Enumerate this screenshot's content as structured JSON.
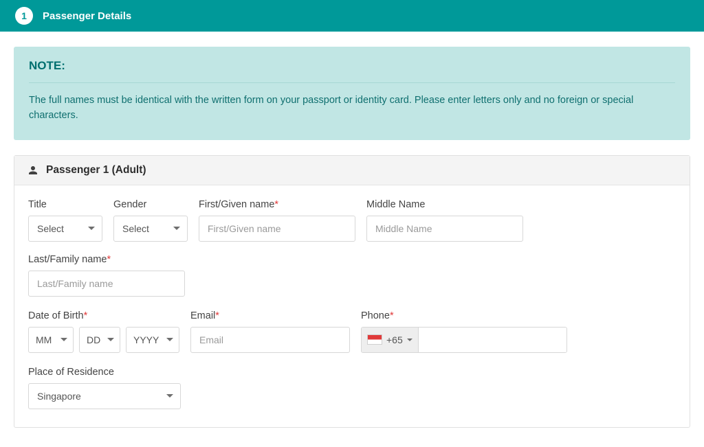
{
  "step": {
    "number": "1",
    "title": "Passenger Details"
  },
  "note": {
    "heading": "NOTE:",
    "text": "The full names must be identical with the written form on your passport or identity card. Please enter letters only and no foreign or special characters."
  },
  "passenger": {
    "header": "Passenger 1 (Adult)",
    "fields": {
      "title": {
        "label": "Title",
        "placeholder": "Select"
      },
      "gender": {
        "label": "Gender",
        "placeholder": "Select"
      },
      "first_name": {
        "label": "First/Given name",
        "placeholder": "First/Given name"
      },
      "middle_name": {
        "label": "Middle Name",
        "placeholder": "Middle Name"
      },
      "last_name": {
        "label": "Last/Family name",
        "placeholder": "Last/Family name"
      },
      "dob": {
        "label": "Date of Birth",
        "mm": "MM",
        "dd": "DD",
        "yyyy": "YYYY"
      },
      "email": {
        "label": "Email",
        "placeholder": "Email"
      },
      "phone": {
        "label": "Phone",
        "dial_code": "+65"
      },
      "residence": {
        "label": "Place of Residence",
        "value": "Singapore"
      }
    }
  }
}
